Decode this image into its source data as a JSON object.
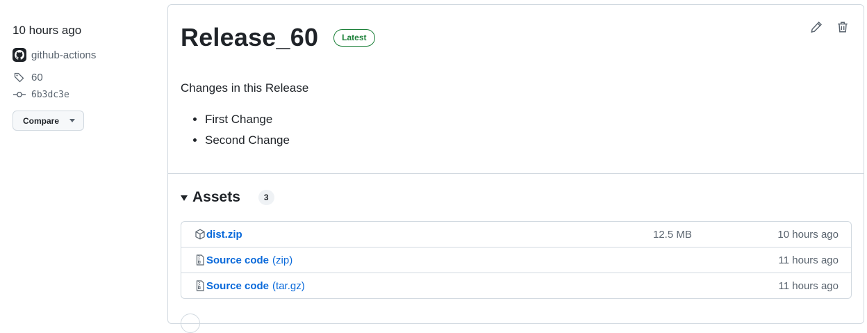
{
  "sidebar": {
    "time": "10 hours ago",
    "author": "github-actions",
    "tag": "60",
    "commit": "6b3dc3e",
    "compare_label": "Compare"
  },
  "release": {
    "title": "Release_60",
    "badge": "Latest",
    "description": "Changes in this Release",
    "changes": [
      "First Change",
      "Second Change"
    ]
  },
  "assets": {
    "title": "Assets",
    "count": "3",
    "items": [
      {
        "icon": "package-icon",
        "name": "dist.zip",
        "suffix": "",
        "size": "12.5 MB",
        "time": "10 hours ago"
      },
      {
        "icon": "file-zip-icon",
        "name": "Source code",
        "suffix": "(zip)",
        "size": "",
        "time": "11 hours ago"
      },
      {
        "icon": "file-zip-icon",
        "name": "Source code",
        "suffix": "(tar.gz)",
        "size": "",
        "time": "11 hours ago"
      }
    ]
  },
  "colors": {
    "link": "#0969da",
    "latest_badge": "#1a7f37",
    "muted": "#59636e",
    "border": "#d1d9e0"
  }
}
